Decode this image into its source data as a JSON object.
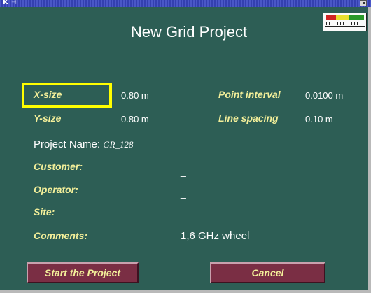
{
  "window": {
    "app_letter": "K",
    "pin_glyph": "⊣"
  },
  "title": "New Grid Project",
  "fields": {
    "x_size": {
      "label": "X-size",
      "value": "0.80 m"
    },
    "y_size": {
      "label": "Y-size",
      "value": "0.80 m"
    },
    "point_interval": {
      "label": "Point interval",
      "value": "0.0100 m"
    },
    "line_spacing": {
      "label": "Line spacing",
      "value": "0.10 m"
    }
  },
  "project_name": {
    "label": "Project Name:",
    "value": "GR_128"
  },
  "info": {
    "customer": {
      "label": "Customer:",
      "value": "_"
    },
    "operator": {
      "label": "Operator:",
      "value": "_"
    },
    "site": {
      "label": "Site:",
      "value": "_"
    },
    "comments": {
      "label": "Comments:",
      "value": "1,6 GHz wheel"
    }
  },
  "buttons": {
    "start": "Start the Project",
    "cancel": "Cancel"
  },
  "colors": {
    "background": "#2d5e55",
    "label": "#f3ef9a",
    "highlight": "#ffff00",
    "button": "#7a2e44"
  },
  "icons": {
    "signal_meter": "signal-meter-icon",
    "close": "close-icon"
  }
}
